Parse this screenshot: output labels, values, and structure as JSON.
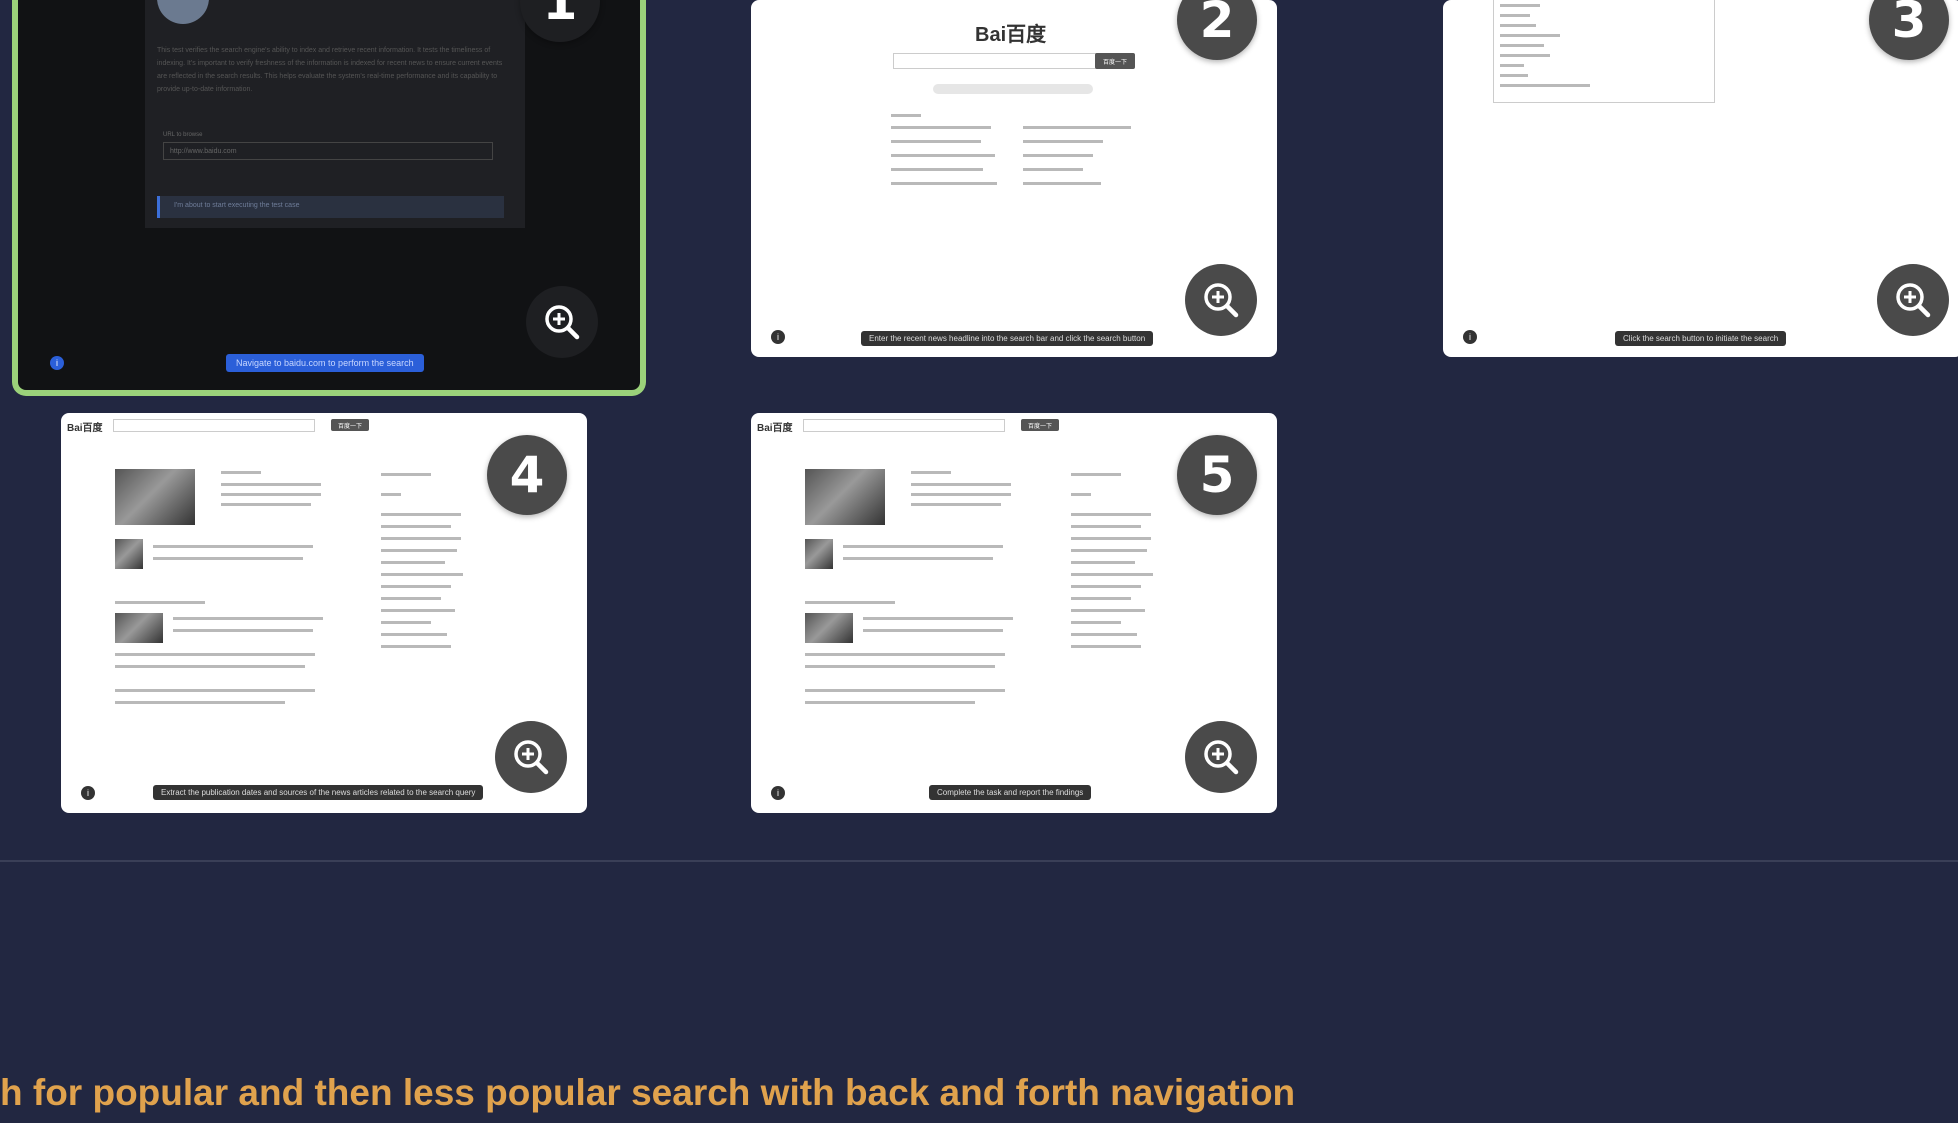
{
  "cards": [
    {
      "number": "1",
      "caption": "Navigate to baidu.com to perform the search",
      "inner": {
        "paragraph": "This test verifies the search engine's ability to index and retrieve recent information. It tests the timeliness of indexing. It's important to verify freshness of the information is indexed for recent news to ensure current events are reflected in the search results. This helps evaluate the system's real-time performance and its capability to provide up-to-date information.",
        "url_label": "URL to browse",
        "url_value": "http://www.baidu.com",
        "status": "I'm about to start executing the test case"
      }
    },
    {
      "number": "2",
      "caption": "Enter the recent news headline into the search bar and click the search button",
      "logo": "Bai百度",
      "search_button": "百度一下"
    },
    {
      "number": "3",
      "caption": "Click the search button to initiate the search"
    },
    {
      "number": "4",
      "caption": "Extract the publication dates and sources of the news articles related to the search query",
      "logo": "Bai百度",
      "search_button": "百度一下"
    },
    {
      "number": "5",
      "caption": "Complete the task and report the findings",
      "logo": "Bai百度",
      "search_button": "百度一下"
    }
  ],
  "bottom_title": "h for popular and then less popular search with back and forth navigation",
  "colors": {
    "background": "#222741",
    "active_border": "#9bd27a",
    "title": "#e0a24d",
    "badge": "#4a4a4a"
  },
  "icons": {
    "zoom": "zoom-in-icon",
    "info": "info-icon"
  }
}
